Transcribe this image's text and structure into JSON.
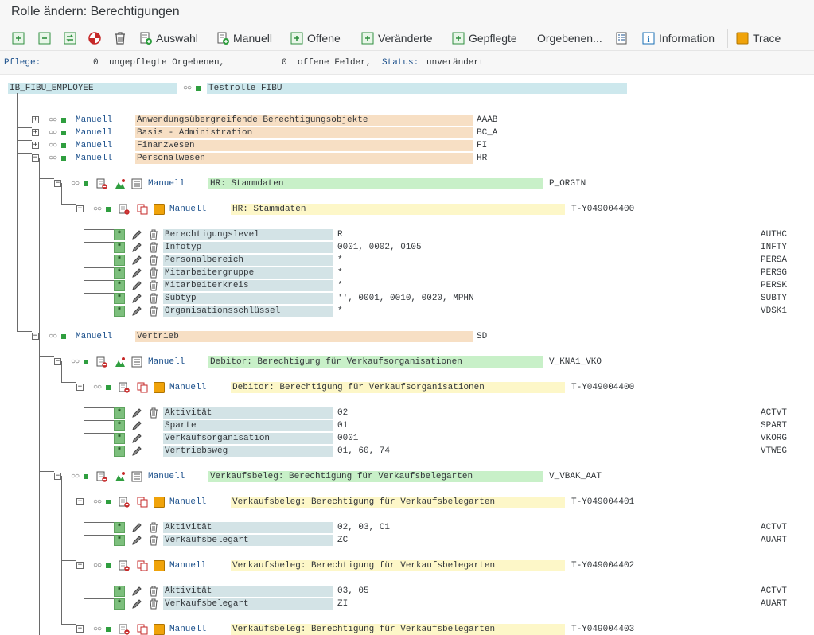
{
  "window": {
    "title": "Rolle ändern: Berechtigungen"
  },
  "toolbar": {
    "auswahl": "Auswahl",
    "manuell": "Manuell",
    "offene": "Offene",
    "veraenderte": "Veränderte",
    "gepflegte": "Gepflegte",
    "orgebenen": "Orgebenen...",
    "information": "Information",
    "trace": "Trace"
  },
  "status": {
    "pflege_label": "Pflege:",
    "ungepflegt_count": "0",
    "ungepflegt_text": "ungepflegte Orgebenen,",
    "offene_count": "0",
    "offene_text": "offene Felder,",
    "status_label": "Status:",
    "status_value": "unverändert"
  },
  "root": {
    "name": "IB_FIBU_EMPLOYEE",
    "text": "Testrolle FIBU"
  },
  "level1": [
    {
      "status": "Manuell",
      "text": "Anwendungsübergreifende Berechtigungsobjekte",
      "code": "AAAB"
    },
    {
      "status": "Manuell",
      "text": "Basis - Administration",
      "code": "BC_A"
    },
    {
      "status": "Manuell",
      "text": "Finanzwesen",
      "code": "FI"
    },
    {
      "status": "Manuell",
      "text": "Personalwesen",
      "code": "HR"
    },
    {
      "status": "Manuell",
      "text": "Vertrieb",
      "code": "SD"
    }
  ],
  "objects": [
    {
      "status": "Manuell",
      "text": "HR: Stammdaten",
      "code": "P_ORGIN"
    },
    {
      "status": "Manuell",
      "text": "Debitor: Berechtigung für Verkaufsorganisationen",
      "code": "V_KNA1_VKO"
    },
    {
      "status": "Manuell",
      "text": "Verkaufsbeleg: Berechtigung für Verkaufsbelegarten",
      "code": "V_VBAK_AAT"
    }
  ],
  "auths": [
    {
      "status": "Manuell",
      "text": "HR: Stammdaten",
      "code": "T-Y049004400"
    },
    {
      "status": "Manuell",
      "text": "Debitor: Berechtigung für Verkaufsorganisationen",
      "code": "T-Y049004400"
    },
    {
      "status": "Manuell",
      "text": "Verkaufsbeleg: Berechtigung für Verkaufsbelegarten",
      "code": "T-Y049004401"
    },
    {
      "status": "Manuell",
      "text": "Verkaufsbeleg: Berechtigung für Verkaufsbelegarten",
      "code": "T-Y049004402"
    },
    {
      "status": "Manuell",
      "text": "Verkaufsbeleg: Berechtigung für Verkaufsbelegarten",
      "code": "T-Y049004403"
    }
  ],
  "fields": [
    {
      "star": "*",
      "name": "Berechtigungslevel",
      "value": "R",
      "code": "AUTHC"
    },
    {
      "star": "*",
      "name": "Infotyp",
      "value": "0001, 0002, 0105",
      "code": "INFTY"
    },
    {
      "star": "*",
      "name": "Personalbereich",
      "value": "*",
      "code": "PERSA"
    },
    {
      "star": "*",
      "name": "Mitarbeitergruppe",
      "value": "*",
      "code": "PERSG"
    },
    {
      "star": "*",
      "name": "Mitarbeiterkreis",
      "value": "*",
      "code": "PERSK"
    },
    {
      "star": "*",
      "name": "Subtyp",
      "value": "'', 0001, 0010, 0020, MPHN",
      "code": "SUBTY"
    },
    {
      "star": "*",
      "name": "Organisationsschlüssel",
      "value": "*",
      "code": "VDSK1"
    },
    {
      "star": "*",
      "name": "Aktivität",
      "value": "02",
      "code": "ACTVT"
    },
    {
      "star": "*",
      "name": "Sparte",
      "value": "01",
      "code": "SPART"
    },
    {
      "star": "*",
      "name": "Verkaufsorganisation",
      "value": "0001",
      "code": "VKORG"
    },
    {
      "star": "*",
      "name": "Vertriebsweg",
      "value": "01, 60, 74",
      "code": "VTWEG"
    },
    {
      "star": "*",
      "name": "Aktivität",
      "value": "02, 03, C1",
      "code": "ACTVT"
    },
    {
      "star": "*",
      "name": "Verkaufsbelegart",
      "value": "ZC",
      "code": "AUART"
    },
    {
      "star": "*",
      "name": "Aktivität",
      "value": "03, 05",
      "code": "ACTVT"
    },
    {
      "star": "*",
      "name": "Verkaufsbelegart",
      "value": "ZI",
      "code": "AUART"
    }
  ],
  "colors": {
    "level1_bg": "#f7dfc4",
    "root_bg": "#cde8ed",
    "object_bg": "#c8f0c8",
    "auth_bg": "#fdf7c8",
    "field_bg": "#d3e3e6",
    "status_blue": "#1a4f8b"
  }
}
